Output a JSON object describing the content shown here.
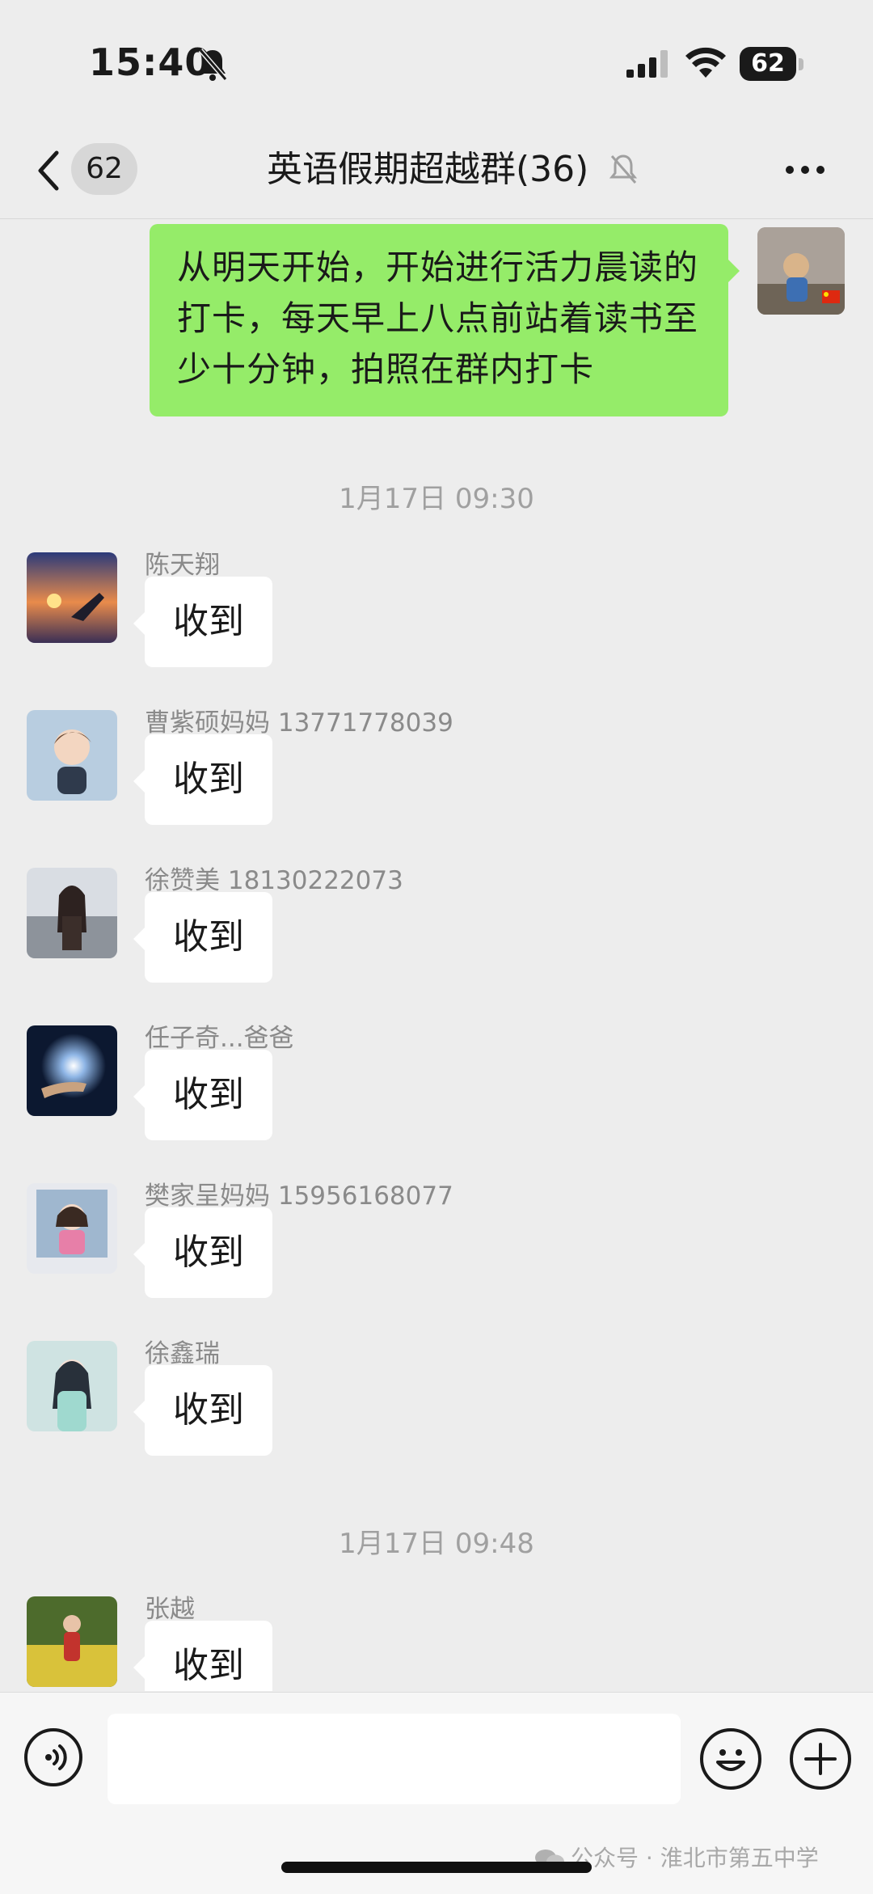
{
  "status_bar": {
    "time": "15:40",
    "battery": "62"
  },
  "header": {
    "back_count": "62",
    "title": "英语假期超越群(36)"
  },
  "my_message": {
    "text": "从明天开始，开始进行活力晨读的打卡，每天早上八点前站着读书至少十分钟，拍照在群内打卡"
  },
  "time_separators": [
    "1月17日 09:30",
    "1月17日 09:48"
  ],
  "messages": [
    {
      "sender": "陈天翔",
      "text": "收到",
      "avatar_icon": "sunset-beach-avatar"
    },
    {
      "sender": "曹紫硕妈妈 13771778039",
      "text": "收到",
      "avatar_icon": "cartoon-girl-avatar"
    },
    {
      "sender": "徐赞美 18130222073",
      "text": "收到",
      "avatar_icon": "girl-snow-avatar"
    },
    {
      "sender": "任子奇...爸爸",
      "text": "收到",
      "avatar_icon": "glowing-hand-avatar"
    },
    {
      "sender": "樊家呈妈妈 15956168077",
      "text": "收到",
      "avatar_icon": "child-photo-avatar"
    },
    {
      "sender": "徐鑫瑞",
      "text": "收到",
      "avatar_icon": "anime-girl-avatar"
    },
    {
      "sender": "张越",
      "text": "收到",
      "avatar_icon": "flower-field-avatar"
    }
  ],
  "input_bar": {
    "placeholder": ""
  },
  "watermark": "公众号 · 淮北市第五中学",
  "colors": {
    "my_bubble": "#95ec69",
    "background": "#ededed",
    "other_bubble": "#ffffff"
  }
}
